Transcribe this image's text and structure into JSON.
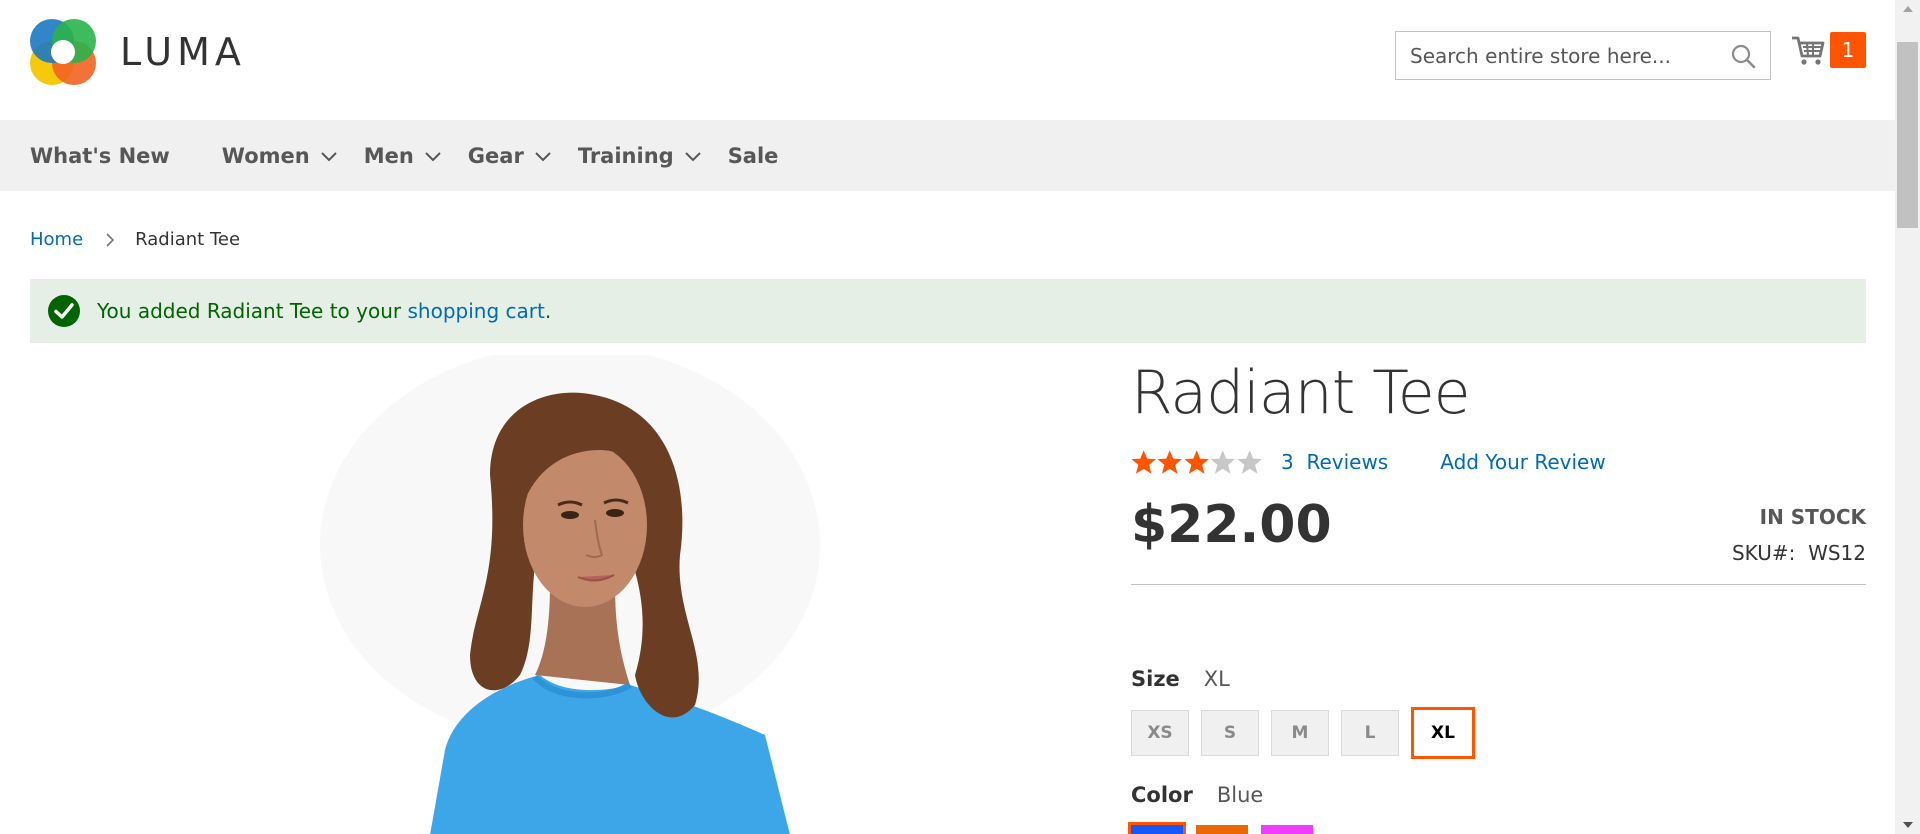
{
  "header": {
    "logo_text": "LUMA",
    "search": {
      "placeholder": "Search entire store here..."
    },
    "cart": {
      "count": "1"
    }
  },
  "nav": {
    "items": [
      {
        "label": "What's New",
        "has_dropdown": false
      },
      {
        "label": "Women",
        "has_dropdown": true
      },
      {
        "label": "Men",
        "has_dropdown": true
      },
      {
        "label": "Gear",
        "has_dropdown": true
      },
      {
        "label": "Training",
        "has_dropdown": true
      },
      {
        "label": "Sale",
        "has_dropdown": false
      }
    ]
  },
  "breadcrumb": {
    "home": "Home",
    "current": "Radiant Tee"
  },
  "message": {
    "prefix": "You added Radiant Tee to your ",
    "link": "shopping cart",
    "suffix": "."
  },
  "product": {
    "title": "Radiant Tee",
    "rating": 3,
    "rating_max": 5,
    "reviews_count": "3",
    "reviews_label": "Reviews",
    "add_review": "Add Your Review",
    "price": "$22.00",
    "stock": "IN STOCK",
    "sku_label": "SKU#:",
    "sku_value": "WS12",
    "size_label": "Size",
    "size_selected": "XL",
    "sizes": [
      "XS",
      "S",
      "M",
      "L",
      "XL"
    ],
    "color_label": "Color",
    "color_selected": "Blue",
    "colors": [
      {
        "name": "Blue",
        "hex": "#1857f7"
      },
      {
        "name": "Orange",
        "hex": "#eb6703"
      },
      {
        "name": "Purple",
        "hex": "#ef3dff"
      }
    ]
  },
  "colors": {
    "accent": "#ff5501",
    "link": "#006bb4",
    "nav_bg": "#f0f0f0",
    "success_bg": "#e5efe5",
    "success_text": "#006400"
  }
}
